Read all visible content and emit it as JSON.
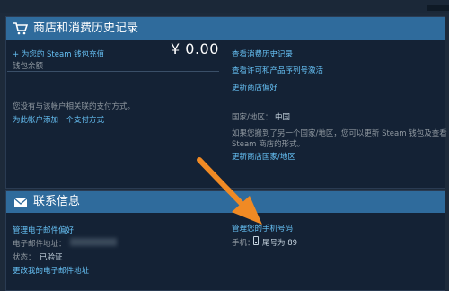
{
  "store": {
    "title": "商店和消费历史记录",
    "add_funds": "+ 为您的 Steam 钱包充值",
    "wallet_label": "钱包余额",
    "balance": "¥ 0.00",
    "no_payment": "您没有与该帐户相关联的支付方式。",
    "add_payment": "为此帐户添加一个支付方式",
    "view_history": "查看消费历史记录",
    "view_licenses": "查看许可和产品序列号激活",
    "update_prefs": "更新商店偏好",
    "country_label": "国家/地区：",
    "country_value": "中国",
    "move_note_line1": "如果您搬到了另一个国家/地区，您可以更新 Steam 钱包及查看",
    "move_note_line2": "Steam 商店的形式。",
    "update_country": "更新商店国家/地区"
  },
  "contact": {
    "title": "联系信息",
    "manage_email_prefs": "管理电子邮件偏好",
    "email_label": "电子邮件地址：",
    "status_label": "状态：",
    "status_value": "已验证",
    "change_email": "更改我的电子邮件地址",
    "manage_phone": "管理您的手机号码",
    "phone_label": "手机：",
    "phone_tail": "尾号为 89"
  },
  "colors": {
    "header": "#2f6b9c",
    "link": "#66c0f4",
    "arrow": "#f08a24"
  },
  "icons": {
    "store_header": "shopping-cart-icon",
    "contact_header": "envelope-icon",
    "phone": "mobile-phone-icon"
  }
}
